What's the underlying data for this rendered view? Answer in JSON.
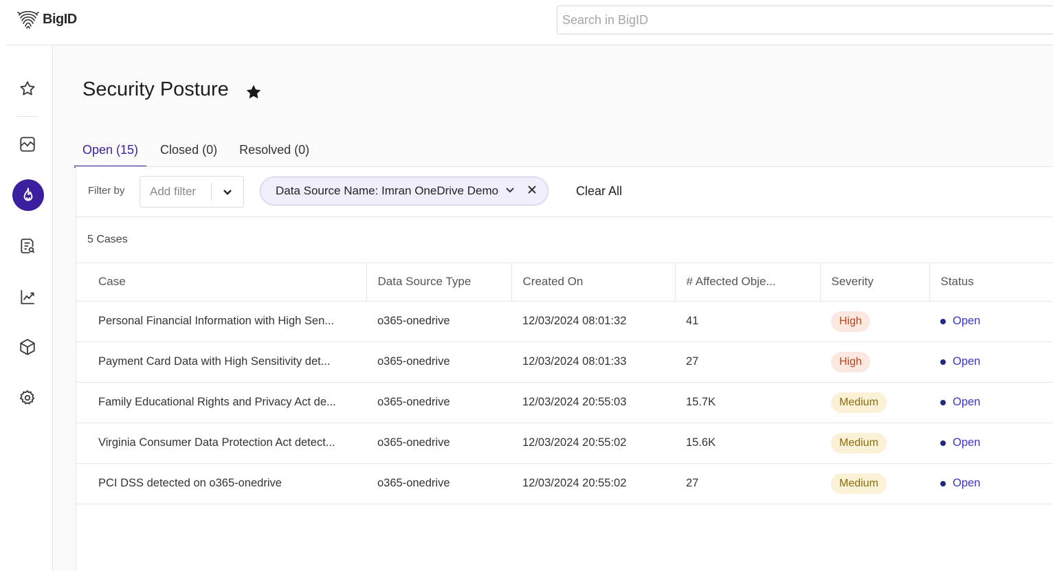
{
  "app": {
    "name": "BigID",
    "search_placeholder": "Search in BigID"
  },
  "sidebar": {
    "items": [
      {
        "icon": "star-icon"
      },
      {
        "icon": "dashboard-icon"
      },
      {
        "icon": "flame-icon",
        "active": true
      },
      {
        "icon": "report-search-icon"
      },
      {
        "icon": "trend-chart-icon"
      },
      {
        "icon": "cube-icon"
      },
      {
        "icon": "gear-icon"
      }
    ]
  },
  "page": {
    "title": "Security Posture",
    "favorite_icon": "star-filled-icon"
  },
  "tabs": [
    {
      "label": "Open (15)",
      "active": true
    },
    {
      "label": "Closed (0)",
      "active": false
    },
    {
      "label": "Resolved (0)",
      "active": false
    }
  ],
  "filter": {
    "label": "Filter by",
    "add_placeholder": "Add filter",
    "chip": "Data Source Name: Imran OneDrive Demo",
    "clear_all": "Clear All"
  },
  "cases_count": "5 Cases",
  "table": {
    "columns": [
      "Case",
      "Data Source Type",
      "Created On",
      "# Affected Obje...",
      "Severity",
      "Status"
    ],
    "rows": [
      {
        "case": "Personal Financial Information with High Sen...",
        "type": "o365-onedrive",
        "created": "12/03/2024 08:01:32",
        "affected": "41",
        "severity": "High",
        "status": "Open"
      },
      {
        "case": "Payment Card Data with High Sensitivity det...",
        "type": "o365-onedrive",
        "created": "12/03/2024 08:01:33",
        "affected": "27",
        "severity": "High",
        "status": "Open"
      },
      {
        "case": "Family Educational Rights and Privacy Act de...",
        "type": "o365-onedrive",
        "created": "12/03/2024 20:55:03",
        "affected": "15.7K",
        "severity": "Medium",
        "status": "Open"
      },
      {
        "case": "Virginia Consumer Data Protection Act detect...",
        "type": "o365-onedrive",
        "created": "12/03/2024 20:55:02",
        "affected": "15.6K",
        "severity": "Medium",
        "status": "Open"
      },
      {
        "case": "PCI DSS detected on o365-onedrive",
        "type": "o365-onedrive",
        "created": "12/03/2024 20:55:02",
        "affected": "27",
        "severity": "Medium",
        "status": "Open"
      }
    ]
  },
  "colors": {
    "accent": "#3c1f9e",
    "high_badge": "#fbe8e1",
    "medium_badge": "#fbf1d6",
    "status_text": "#3a36c4"
  }
}
